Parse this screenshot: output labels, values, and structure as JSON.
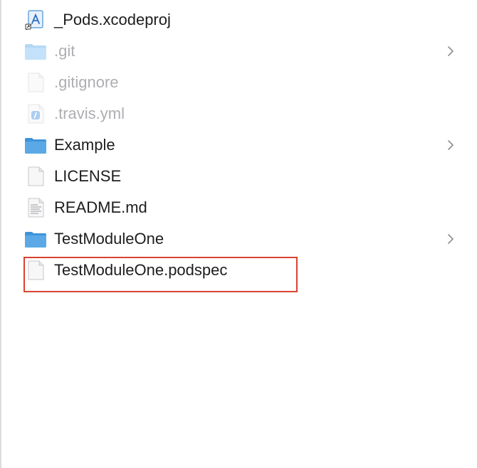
{
  "files": [
    {
      "name": "_Pods.xcodeproj",
      "icon": "xcodeproj-icon",
      "hidden": false,
      "folder": false
    },
    {
      "name": ".git",
      "icon": "folder-icon",
      "hidden": true,
      "folder": true
    },
    {
      "name": ".gitignore",
      "icon": "blank-file-icon",
      "hidden": true,
      "folder": false
    },
    {
      "name": ".travis.yml",
      "icon": "yaml-file-icon",
      "hidden": true,
      "folder": false
    },
    {
      "name": "Example",
      "icon": "folder-icon",
      "hidden": false,
      "folder": true
    },
    {
      "name": "LICENSE",
      "icon": "blank-file-icon",
      "hidden": false,
      "folder": false
    },
    {
      "name": "README.md",
      "icon": "text-file-icon",
      "hidden": false,
      "folder": false
    },
    {
      "name": "TestModuleOne",
      "icon": "folder-icon",
      "hidden": false,
      "folder": true
    },
    {
      "name": "TestModuleOne.podspec",
      "icon": "blank-file-icon",
      "hidden": false,
      "folder": false,
      "highlighted": true
    }
  ],
  "colors": {
    "folder": "#5aa9e6",
    "highlight": "#d9432f",
    "text": "#1d1d1f",
    "hidden_text": "#aeaeb2"
  }
}
